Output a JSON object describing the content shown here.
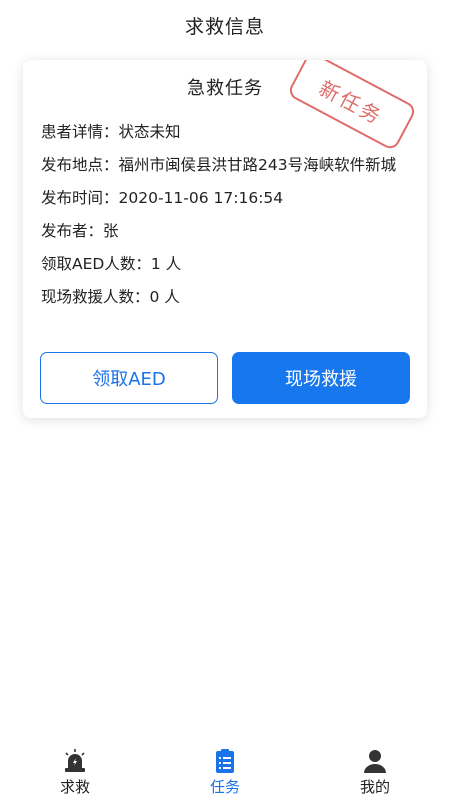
{
  "header": {
    "title": "求救信息"
  },
  "card": {
    "title": "急救任务",
    "stamp": "新任务",
    "rows": [
      {
        "label": "患者详情：",
        "value": "状态未知"
      },
      {
        "label": "发布地点：",
        "value": "福州市闽侯县洪甘路243号海峡软件新城"
      },
      {
        "label": "发布时间：",
        "value": "2020-11-06 17:16:54"
      },
      {
        "label": "发布者：",
        "value": "张"
      },
      {
        "label": "领取AED人数：",
        "value": "1 人"
      },
      {
        "label": "现场救援人数：",
        "value": "0 人"
      }
    ],
    "buttons": {
      "aed": "领取AED",
      "rescue": "现场救援"
    }
  },
  "tabbar": {
    "items": [
      {
        "label": "求救",
        "icon": "alarm-light-icon",
        "active": false
      },
      {
        "label": "任务",
        "icon": "clipboard-list-icon",
        "active": true
      },
      {
        "label": "我的",
        "icon": "user-icon",
        "active": false
      }
    ]
  },
  "colors": {
    "accent": "#1677ef",
    "stamp": "#d9534f"
  }
}
